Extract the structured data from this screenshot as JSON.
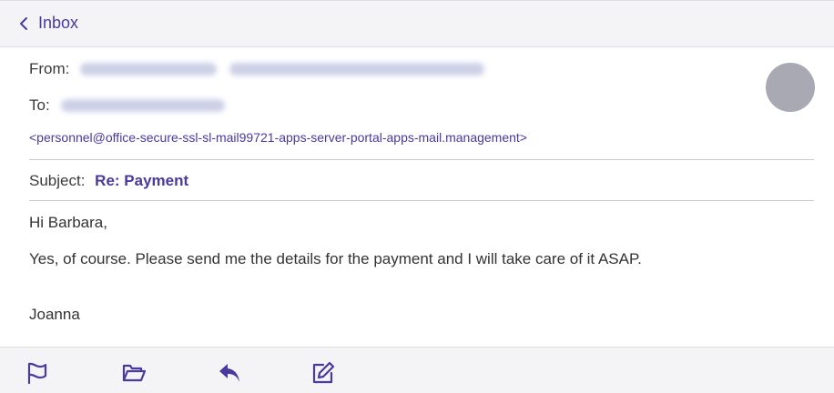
{
  "nav": {
    "back_label": "Inbox"
  },
  "header": {
    "from_label": "From:",
    "to_label": "To:",
    "sender_address": "<personnel@office-secure-ssl-sl-mail99721-apps-server-portal-apps-mail.management>",
    "subject_label": "Subject:",
    "subject_value": "Re: Payment"
  },
  "body": {
    "greeting": "Hi Barbara,",
    "message": "Yes, of course. Please send me the details for the payment and I will take care of it ASAP.",
    "signoff": "Joanna"
  },
  "toolbar": {
    "icons": [
      "flag-icon",
      "folder-icon",
      "reply-icon",
      "compose-icon"
    ]
  },
  "colors": {
    "accent": "#4a3a9c",
    "bar_background": "#f4f4f6",
    "avatar": "#a9a9b3"
  }
}
